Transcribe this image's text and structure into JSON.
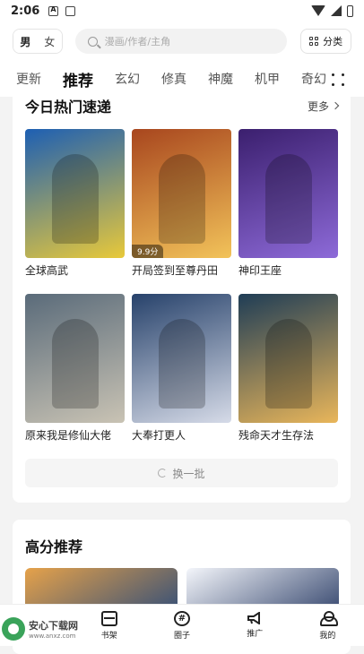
{
  "status_bar": {
    "time": "2:06"
  },
  "top_bar": {
    "gender_male": "男",
    "gender_female": "女",
    "search_placeholder": "漫画/作者/主角",
    "classify_label": "分类"
  },
  "tabs": [
    {
      "label": "更新",
      "active": false
    },
    {
      "label": "推荐",
      "active": true
    },
    {
      "label": "玄幻",
      "active": false
    },
    {
      "label": "修真",
      "active": false
    },
    {
      "label": "神魔",
      "active": false
    },
    {
      "label": "机甲",
      "active": false
    },
    {
      "label": "奇幻",
      "active": false
    }
  ],
  "hot_section": {
    "title": "今日热门速递",
    "more_label": "更多",
    "refresh_label": "换一批",
    "items": [
      {
        "title": "全球高武",
        "badge": "",
        "colors": [
          "#1d5fb3",
          "#e8c93a"
        ]
      },
      {
        "title": "开局签到至尊丹田",
        "badge": "9.9分",
        "colors": [
          "#a8461e",
          "#f2c35a"
        ]
      },
      {
        "title": "神印王座",
        "badge": "",
        "colors": [
          "#3b1f6e",
          "#8d6ad8"
        ]
      },
      {
        "title": "原来我是修仙大佬",
        "badge": "",
        "colors": [
          "#5a6b7a",
          "#c9c3b4"
        ]
      },
      {
        "title": "大奉打更人",
        "badge": "",
        "colors": [
          "#27426b",
          "#d6dbe8"
        ]
      },
      {
        "title": "残命天才生存法",
        "badge": "",
        "colors": [
          "#1f3d56",
          "#e9b65a"
        ]
      }
    ]
  },
  "high_score_section": {
    "title": "高分推荐",
    "cover_colors": [
      [
        "#e6a24a",
        "#2a4a7a"
      ],
      [
        "#f4f6fb",
        "#2b3d66"
      ]
    ]
  },
  "bottom_nav": [
    {
      "label": "书架",
      "icon": "bookshelf-icon"
    },
    {
      "label": "圈子",
      "icon": "hash-circle-icon"
    },
    {
      "label": "推广",
      "icon": "megaphone-icon"
    },
    {
      "label": "我的",
      "icon": "user-icon"
    }
  ],
  "watermark": {
    "main": "安心下载网",
    "sub": "www.anxz.com"
  }
}
